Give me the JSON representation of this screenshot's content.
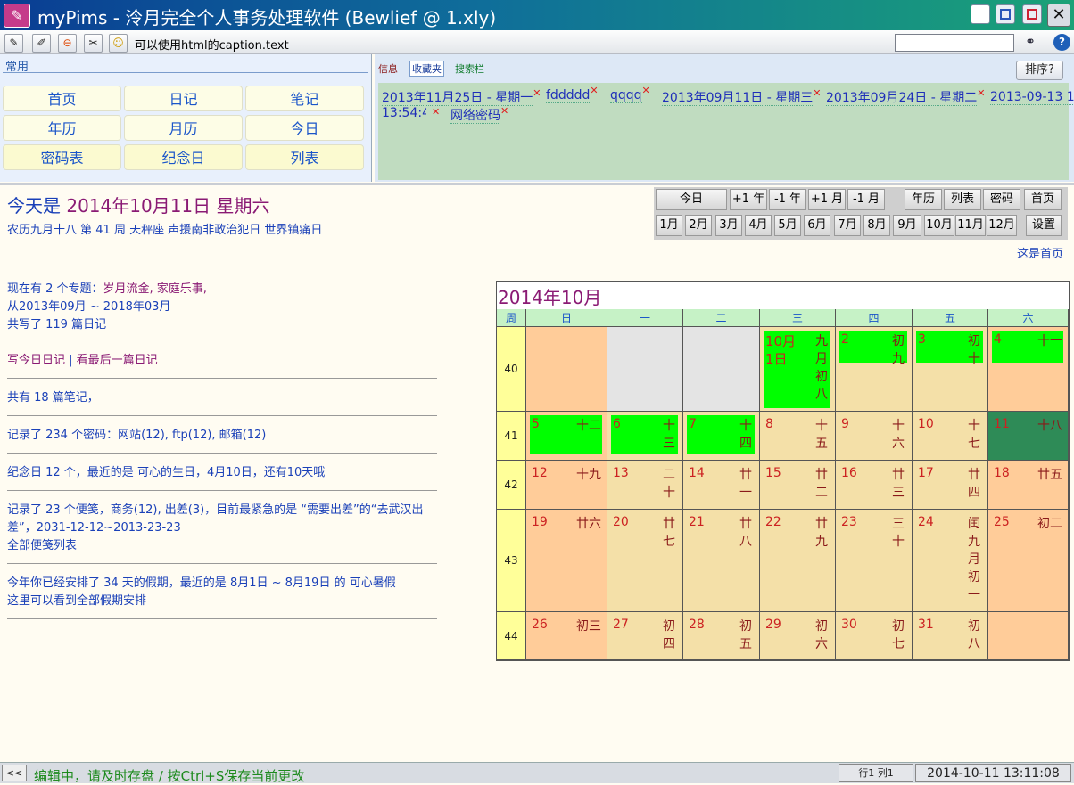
{
  "window": {
    "title": "myPims - 泠月完全个人事务处理软件 (Bewlief @ 1.xly)"
  },
  "toolbar": {
    "caption": "可以使用html的caption.text",
    "search_value": ""
  },
  "quick": {
    "section_title": "常用",
    "buttons": [
      "首页",
      "日记",
      "笔记",
      "年历",
      "月历",
      "今日",
      "密码表",
      "纪念日",
      "列表"
    ]
  },
  "tabs": {
    "info": "信息",
    "fav": "收藏夹",
    "search": "搜索栏",
    "sort": "排序?"
  },
  "favorites": [
    "2013年11月25日 - 星期一",
    "fddddd",
    "qqqq",
    "2013年09月11日 - 星期三",
    "2013年09月24日 - 星期二",
    "2013-09-13 13:54:45",
    "网络密码"
  ],
  "today": {
    "prefix": "今天是",
    "date": "2014年10月11日 星期六",
    "lunar": "农历九月十八 第 41 周 天秤座 声援南非政治犯日 世界镇痛日"
  },
  "info": {
    "l1": "现在有 2 个专题：",
    "l1b": "岁月流金, 家庭乐事,",
    "l2": "从2013年09月 ~ 2018年03月",
    "l3": "共写了 119 篇日记",
    "l4a": "写今日日记",
    "l4sep": " | ",
    "l4b": "看最后一篇日记",
    "l5": "共有 18 篇笔记，",
    "l6": "记录了 234 个密码：网站(12), ftp(12), 邮箱(12)",
    "l7": "纪念日 12 个，最近的是 可心的生日，4月10日，还有10天哦",
    "l8": "记录了 23 个便笺，商务(12), 出差(3)，目前最紧急的是 “需要出差”的“去武汉出差”，2031-12-12~2013-23-23",
    "l9": "全部便笺列表",
    "l10": "今年你已经安排了 34 天的假期，最近的是 8月1日 ~ 8月19日 的 可心暑假",
    "l11": "这里可以看到全部假期安排"
  },
  "nav": {
    "buttons": [
      "今日",
      "+1 年",
      "-1 年",
      "+1 月",
      "-1 月",
      "年历",
      "列表",
      "密码",
      "首页"
    ],
    "months": [
      "1月",
      "2月",
      "3月",
      "4月",
      "5月",
      "6月",
      "7月",
      "8月",
      "9月",
      "10月",
      "11月",
      "12月",
      "设置"
    ],
    "homepage_label": "这是首页"
  },
  "calendar": {
    "title": "2014年10月",
    "headers": [
      "周",
      "日",
      "一",
      "二",
      "三",
      "四",
      "五",
      "六"
    ],
    "weeks": [
      {
        "wk": "40",
        "days": [
          [
            "",
            ""
          ],
          [
            "",
            ""
          ],
          [
            "",
            ""
          ],
          [
            "10月1日",
            "九月初八"
          ],
          [
            "2",
            "初九"
          ],
          [
            "3",
            "初十"
          ],
          [
            "4",
            "十一"
          ]
        ]
      },
      {
        "wk": "41",
        "days": [
          [
            "5",
            "十二"
          ],
          [
            "6",
            "十三"
          ],
          [
            "7",
            "十四"
          ],
          [
            "8",
            "十五"
          ],
          [
            "9",
            "十六"
          ],
          [
            "10",
            "十七"
          ],
          [
            "11",
            "十八"
          ]
        ]
      },
      {
        "wk": "42",
        "days": [
          [
            "12",
            "十九"
          ],
          [
            "13",
            "二十"
          ],
          [
            "14",
            "廿一"
          ],
          [
            "15",
            "廿二"
          ],
          [
            "16",
            "廿三"
          ],
          [
            "17",
            "廿四"
          ],
          [
            "18",
            "廿五"
          ]
        ]
      },
      {
        "wk": "43",
        "days": [
          [
            "19",
            "廿六"
          ],
          [
            "20",
            "廿七"
          ],
          [
            "21",
            "廿八"
          ],
          [
            "22",
            "廿九"
          ],
          [
            "23",
            "三十"
          ],
          [
            "24",
            "闰九月初一"
          ],
          [
            "25",
            "初二"
          ]
        ]
      },
      {
        "wk": "44",
        "days": [
          [
            "26",
            "初三"
          ],
          [
            "27",
            "初四"
          ],
          [
            "28",
            "初五"
          ],
          [
            "29",
            "初六"
          ],
          [
            "30",
            "初七"
          ],
          [
            "31",
            "初八"
          ],
          [
            "",
            ""
          ]
        ]
      }
    ]
  },
  "status": {
    "left": "<<",
    "message": "编辑中，请及时存盘 / 按Ctrl+S保存当前更改",
    "position": "行1 列1",
    "time": "2014-10-11 13:11:08"
  },
  "colors": {
    "weekend": "#ffcc99",
    "weekday": "#f4e0a8",
    "empty": "#e4e4e4",
    "event": "#00ff00",
    "today": "#2e8b57"
  }
}
